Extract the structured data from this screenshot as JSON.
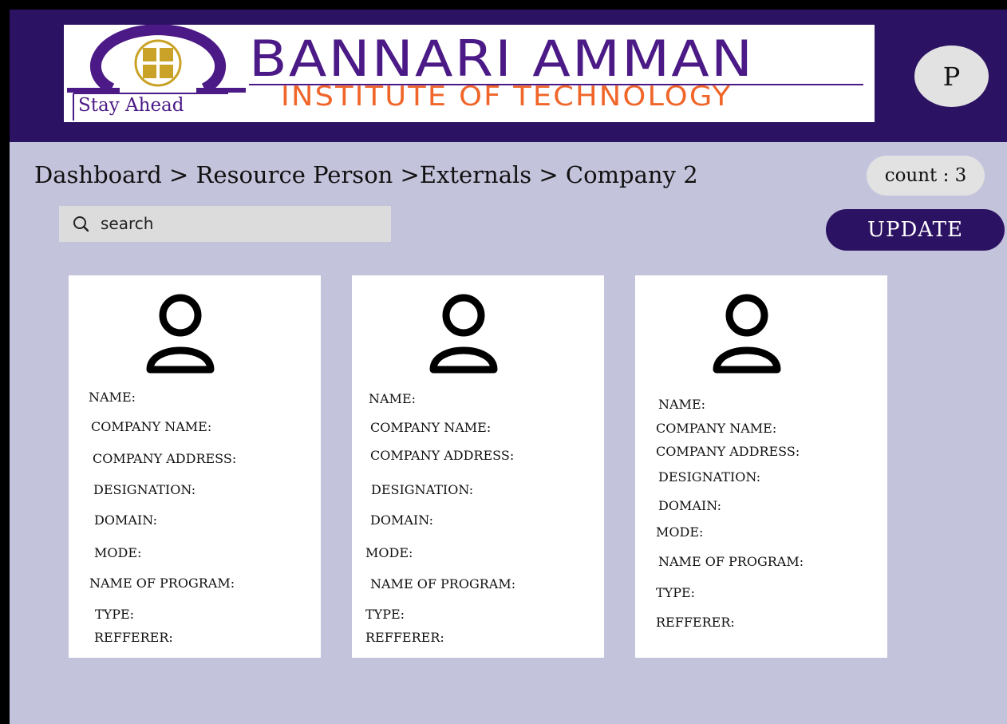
{
  "header": {
    "logo": {
      "emblem_letters": "BIT",
      "name": "BANNARI AMMAN",
      "subtitle": "INSTITUTE OF TECHNOLOGY",
      "tagline": "Stay Ahead"
    },
    "avatar_initial": "P"
  },
  "breadcrumb": "Dashboard > Resource Person >Externals > Company 2",
  "count_label": "count : 3",
  "search": {
    "placeholder": "search",
    "value": ""
  },
  "update_label": "UPDATE",
  "cards": [
    {
      "fields": [
        "NAME:",
        "COMPANY NAME:",
        "COMPANY ADDRESS:",
        "DESIGNATION:",
        "DOMAIN:",
        "MODE:",
        "NAME OF PROGRAM:",
        "TYPE:",
        "REFFERER:"
      ]
    },
    {
      "fields": [
        "NAME:",
        "COMPANY NAME:",
        "COMPANY ADDRESS:",
        "DESIGNATION:",
        "DOMAIN:",
        "MODE:",
        "NAME OF PROGRAM:",
        "TYPE:",
        "REFFERER:"
      ]
    },
    {
      "fields": [
        "NAME:",
        "COMPANY NAME:",
        "COMPANY ADDRESS:",
        "DESIGNATION:",
        "DOMAIN:",
        "MODE:",
        "NAME OF PROGRAM:",
        "TYPE:",
        "REFFERER:"
      ]
    }
  ],
  "colors": {
    "header_bg": "#2c1263",
    "page_bg": "#c4c3dc",
    "brand_purple": "#4b1a86",
    "brand_orange": "#f0662a",
    "update_bg": "#2c1263"
  },
  "icons": [
    "logo-emblem-icon",
    "search-icon",
    "person-icon"
  ]
}
